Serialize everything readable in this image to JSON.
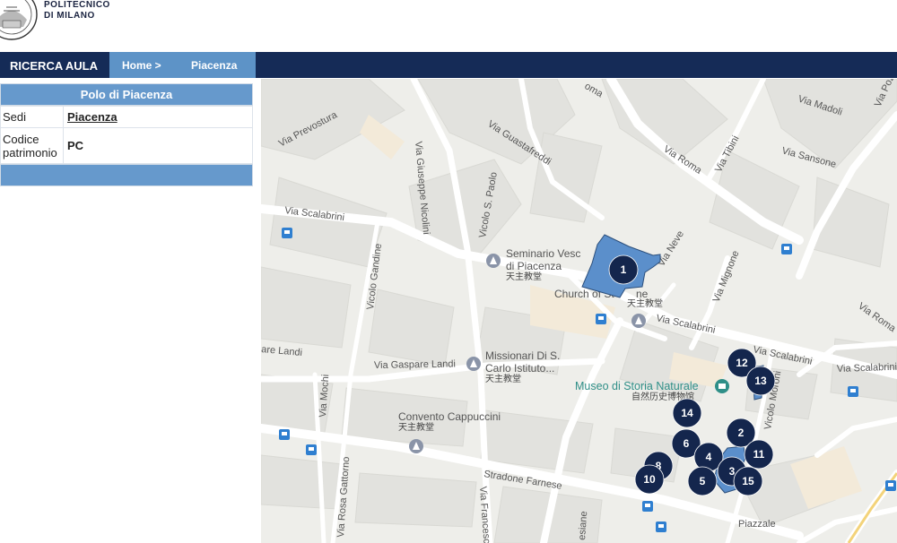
{
  "header": {
    "brand_line1": "POLITECNICO",
    "brand_line2": "DI MILANO"
  },
  "nav": {
    "title": "RICERCA AULA",
    "breadcrumb": [
      "Home >",
      "Piacenza"
    ]
  },
  "panel": {
    "title": "Polo di Piacenza",
    "rows": [
      {
        "label": "Sedi",
        "value": "Piacenza"
      },
      {
        "label_line1": "Codice",
        "label_line2": "patrimonio",
        "value": "PC"
      }
    ]
  },
  "map": {
    "streets": [
      "Via Prevostura",
      "Via Guastafreddi",
      "Via Madoli",
      "Via Roma",
      "Via Tibini",
      "Via Sansone",
      "Via Giuseppe Nicolini",
      "Vicolo S. Paolo",
      "Via Scalabrini",
      "Via Neve",
      "Via Mignone",
      "Via Roma",
      "Vicolo Gandine",
      "Via Scalabrini",
      "are Landi",
      "Via Gaspare Landi",
      "Via Scalabrini",
      "Via Scalabrini",
      "Via Mochi",
      "Vicolo Moroni",
      "Stradone Farnese",
      "Via Rosa Gattorno",
      "Via Francesco",
      "Piazzale",
      "esiane",
      "Via Pozz",
      "oma"
    ],
    "pois": [
      {
        "name": "Seminario Vesc",
        "name2": "di Piacenza",
        "sub": "天主教堂"
      },
      {
        "name": "Church of St",
        "name2": "ne",
        "sub": "天主教堂"
      },
      {
        "name": "Missionari Di S.",
        "name2": "Carlo Istituto...",
        "sub": "天主教堂"
      },
      {
        "name": "Museo di Storia Naturale",
        "sub": "自然历史博物馆"
      },
      {
        "name": "Convento Cappuccini",
        "sub": "天主教堂"
      }
    ],
    "markers": [
      "1",
      "12",
      "13",
      "14",
      "2",
      "6",
      "11",
      "4",
      "8",
      "3",
      "10",
      "5",
      "15"
    ],
    "marker_color": "#14264d",
    "building_color": "#5b8fcb"
  }
}
